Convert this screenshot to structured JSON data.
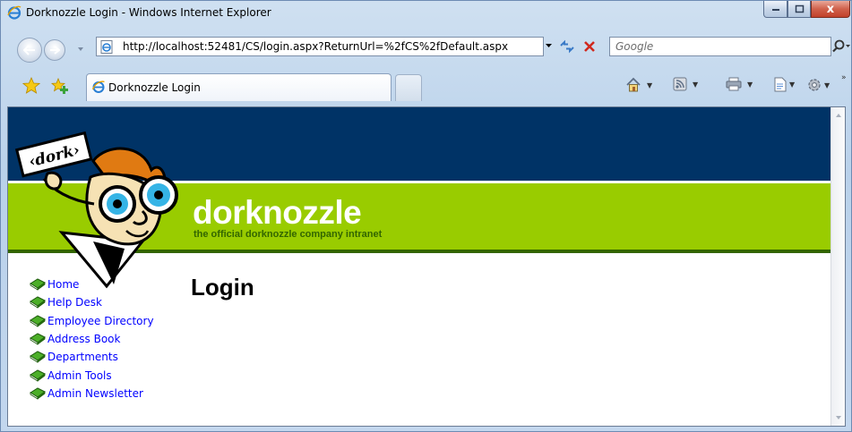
{
  "window": {
    "title": "Dorknozzle Login - Windows Internet Explorer",
    "close_glyph": "x"
  },
  "address_bar": {
    "url": "http://localhost:52481/CS/login.aspx?ReturnUrl=%2fCS%2fDefault.aspx",
    "search_placeholder": "Google"
  },
  "tabs": [
    {
      "label": "Dorknozzle Login",
      "icon": "ie-page-icon",
      "active": true
    }
  ],
  "toolbar": {
    "icons": [
      "home-icon",
      "feeds-icon",
      "print-icon",
      "page-icon",
      "tools-icon"
    ],
    "more_glyph": "»"
  },
  "site": {
    "name": "dorknozzle",
    "tagline": "the official dorknozzle company intranet",
    "logo_sign_text": "‹dork›",
    "colors": {
      "header_navy": "#003366",
      "header_green": "#99cc00",
      "rule_green": "#336600",
      "link": "#0000ff"
    }
  },
  "menu": {
    "items": [
      {
        "label": "Home"
      },
      {
        "label": "Help Desk"
      },
      {
        "label": "Employee Directory"
      },
      {
        "label": "Address Book"
      },
      {
        "label": "Departments"
      },
      {
        "label": "Admin Tools"
      },
      {
        "label": "Admin Newsletter"
      }
    ]
  },
  "main": {
    "heading": "Login"
  }
}
